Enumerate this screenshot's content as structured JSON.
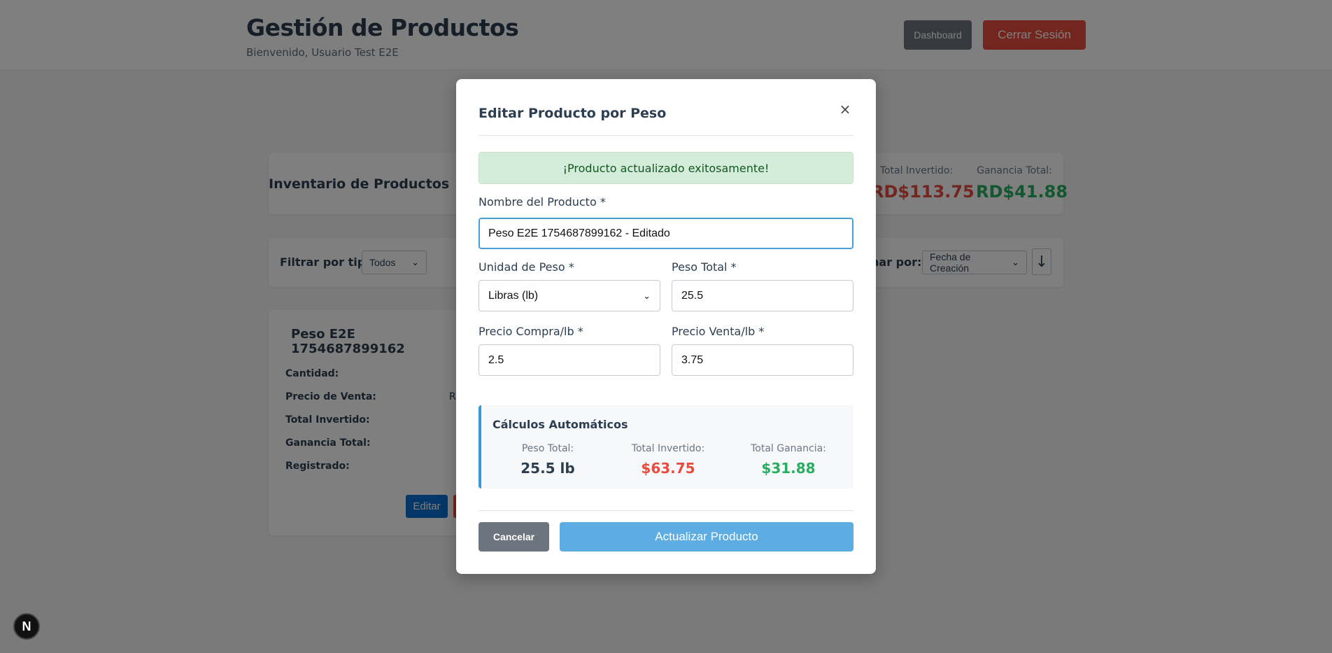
{
  "header": {
    "title": "Gestión de Productos",
    "subtitle": "Bienvenido, Usuario Test E2E",
    "dashboard_label": "Dashboard",
    "logout_label": "Cerrar Sesión"
  },
  "inventory": {
    "title": "Inventario de Productos",
    "stats": [
      {
        "label": "Total Invertido:",
        "value": "RD$113.75",
        "color": "#e74c3c"
      },
      {
        "label": "Ganancia Total:",
        "value": "RD$41.88",
        "color": "#27ae60"
      }
    ]
  },
  "filters": {
    "type_label": "Filtrar por tipo:",
    "type_value": "Todos",
    "sort_label": "nar por:",
    "sort_value": "Fecha de Creación",
    "sort_direction_icon": "↓"
  },
  "product_card": {
    "name": "Peso E2E 1754687899162",
    "rows": [
      "Cantidad:",
      "Precio de Venta:",
      "Total Invertido:",
      "Ganancia Total:",
      "Registrado:"
    ],
    "partial_value": "R",
    "edit_label": "Editar"
  },
  "modal": {
    "title": "Editar Producto por Peso",
    "close_icon": "×",
    "success_message": "¡Producto actualizado exitosamente!",
    "fields": {
      "name": {
        "label": "Nombre del Producto *",
        "value": "Peso E2E 1754687899162 - Editado"
      },
      "unit": {
        "label": "Unidad de Peso *",
        "value": "Libras (lb)"
      },
      "total_weight": {
        "label": "Peso Total *",
        "value": "25.5"
      },
      "buy_price": {
        "label": "Precio Compra/lb *",
        "value": "2.5"
      },
      "sell_price": {
        "label": "Precio Venta/lb *",
        "value": "3.75"
      }
    },
    "calculations": {
      "title": "Cálculos Automáticos",
      "items": [
        {
          "label": "Peso Total:",
          "value": "25.5 lb",
          "color": "#2c3e50"
        },
        {
          "label": "Total Invertido:",
          "value": "$63.75",
          "color": "#e74c3c"
        },
        {
          "label": "Total Ganancia:",
          "value": "$31.88",
          "color": "#27ae60"
        }
      ]
    },
    "cancel_label": "Cancelar",
    "update_label": "Actualizar Producto"
  },
  "badge": {
    "letter": "N"
  }
}
